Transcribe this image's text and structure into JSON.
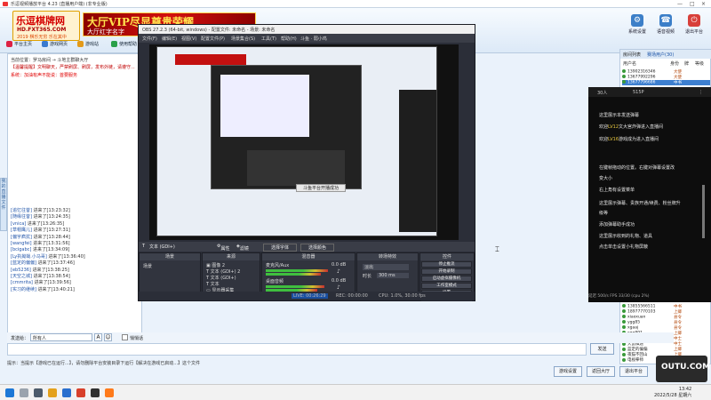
{
  "window": {
    "title": "乐逗视频播放平台 4.23 (直播用户端) (非专业版)"
  },
  "header": {
    "logo_main": "乐逗棋牌网",
    "logo_sub": "HD.FXT365.COM",
    "logo_tag": "2019 棋乐无穷 乐在其中",
    "banner_main": "大厅VIP尽显尊贵荣耀",
    "banner_sub": "大厅红字名字",
    "buttons": [
      {
        "icon": "⚙",
        "label": "系统设置"
      },
      {
        "icon": "☎",
        "label": "语音视频"
      },
      {
        "icon": "⏻",
        "label": "退出平台"
      }
    ]
  },
  "toolbar": [
    "平台主页",
    "游戏网页",
    "游戏站",
    "使用帮助"
  ],
  "left": {
    "location": "当前位置：罗马房间 → 斗地主群聊大厅",
    "announce": "【温馨提醒】文明聊天，严禁刷屏、刷屏，发布外链，请遵守...",
    "warn": "系统：加油有声不能说：首要服务",
    "side_tab": [
      "我的",
      "直播",
      "文件"
    ],
    "chat": [
      {
        "name": "[追忆往昔]",
        "text": " 进来了[13:23:32]"
      },
      {
        "name": "[随缘往昔]",
        "text": " 进来了[13:24:35]"
      },
      {
        "name": "[vnica]",
        "text": " 进来了[13:26:35]"
      },
      {
        "name": "[草帽鹰儿]",
        "text": " 进来了[13:27:31]"
      },
      {
        "name": "[偏宇疯扰]",
        "text": " 进来了[13:28:44]"
      },
      {
        "name": "[wangfei]",
        "text": " 进来了[13:31:56]"
      },
      {
        "name": "[bcigabc]",
        "text": " 进来了[13:34:09]"
      },
      {
        "name": "[Ly执拗哉.小马哥]",
        "text": " 进来了[13:36:40]"
      },
      {
        "name": "[蓝定的偏偏]",
        "text": " 进来了[13:37:46]"
      },
      {
        "name": "[eb5236]",
        "text": " 进来了[13:38:25]"
      },
      {
        "name": "[天空之城]",
        "text": " 进来了[13:38:54]"
      },
      {
        "name": "[cmmrita]",
        "text": " 进来了[13:39:56]"
      },
      {
        "name": "[实习的继续]",
        "text": " 进来了[13:40:21]"
      }
    ]
  },
  "send": {
    "label": "发送给：",
    "target": "所有人",
    "private": "悄悄话",
    "send_button": "发送"
  },
  "tips": "提示：当提示【游戏已在运行...】，请勿删除平台安装目录下运行【解决在游戏已启动...】这个文件",
  "bottom_buttons": [
    "游戏设置",
    "返回大厅",
    "退出平台"
  ],
  "obs": {
    "title": "OBS 27.2.3 (64-bit, windows) - 配置文件: 未命名 - 场景: 未命名",
    "menu": [
      "文件(F)",
      "编辑(E)",
      "视图(V)",
      "配置文件(P)",
      "场景集合(S)",
      "工具(T)",
      "帮助(H)",
      "斗鱼 · 弱小鸡"
    ],
    "source_bar": [
      "文本 (GDI+)",
      "属性",
      "滤镜",
      "选择字体",
      "选择颜色"
    ],
    "docks": {
      "scenes": "场景",
      "sources": "来源",
      "mixer": "混音器",
      "transitions": "转场特效",
      "controls": "控件"
    },
    "scene_items": [
      "场景"
    ],
    "source_items": [
      "图像 2",
      "文本 (GDI+) 2",
      "文本 (GDI+)",
      "文本",
      "显示器采集"
    ],
    "mixer_items": [
      {
        "name": "麦克风/Aux",
        "db": "0.0 dB"
      },
      {
        "name": "桌面音频",
        "db": "0.0 dB"
      }
    ],
    "transition": "淡出",
    "duration_label": "时长",
    "duration": "300 ms",
    "control_buttons": [
      "停止推流",
      "开始录制",
      "启动虚拟摄像机",
      "工作室模式",
      "设置",
      "退出"
    ],
    "status": [
      "LIVE: 00:26:29",
      "REC: 00:00:00",
      "CPU: 1.0%, 30.00 fps"
    ],
    "toast": "斗鱼平台开播成功"
  },
  "overlay": {
    "tabs": [
      "30人",
      "515P"
    ],
    "lines": [
      {
        "pre": "",
        "hl": "",
        "post": "这里展示本发送弹幕"
      },
      {
        "pre": "欢迎",
        "hl": "LV12",
        "post": "文大宫炸弹进入直播间"
      },
      {
        "pre": "欢迎",
        "hl": "LV16",
        "post": "游戏成为进入直播间"
      },
      {
        "pre": "",
        "hl": "",
        "post": "在键帧拖动的位置。右键对弹幕设置改"
      },
      {
        "pre": "",
        "hl": "",
        "post": "变大小"
      },
      {
        "pre": "",
        "hl": "",
        "post": "右上角有设置菜单"
      },
      {
        "pre": "",
        "hl": "",
        "post": "这里展示弹幕、贵族开通/续费、粉丝牌升"
      },
      {
        "pre": "",
        "hl": "",
        "post": "级等"
      },
      {
        "pre": "",
        "hl": "",
        "post": "添加弹幕助手成功"
      },
      {
        "pre": "",
        "hl": "",
        "post": "这里展示收到的礼物、道具"
      },
      {
        "pre": "",
        "hl": "",
        "post": "点击单击设置小礼物屏蔽"
      }
    ],
    "footer": "延迟 500/s FPS 33/30 (cpu 2%)"
  },
  "right": {
    "tabs": [
      "房间列表",
      "赛场用户(30)"
    ],
    "columns": [
      "用户名",
      "身份",
      "牌",
      "等级"
    ],
    "users": [
      {
        "name": "13902316346",
        "role": "大使"
      },
      {
        "name": "13677992296",
        "role": "大使"
      },
      {
        "name": "13677796686",
        "role": "中书"
      },
      {
        "name": "13855566511",
        "role": "中书"
      },
      {
        "name": "18977770103",
        "role": "上卿"
      },
      {
        "name": "xiaoxuan",
        "role": "县令"
      },
      {
        "name": "ygg85",
        "role": "县令"
      },
      {
        "name": "xgaaj",
        "role": "县令"
      },
      {
        "name": "xgg891",
        "role": "上卿"
      },
      {
        "name": "灵龙",
        "role": "中士"
      },
      {
        "name": "大鼠棋途",
        "role": "中士"
      },
      {
        "name": "蓝定的偏偏",
        "role": "上卿"
      },
      {
        "name": "夜猫不回山",
        "role": "上卿"
      },
      {
        "name": "电视拳师",
        "role": "上卿"
      },
      {
        "name": "黄金",
        "role": "上卿"
      }
    ]
  },
  "watermark": "OUTU.COM",
  "clock": {
    "time": "13:42",
    "date": "2022/5/28 星期六"
  },
  "colors": {
    "accent": "#3c7fc8",
    "obs_bg": "#2b2e38",
    "banner_red": "#d31010"
  }
}
